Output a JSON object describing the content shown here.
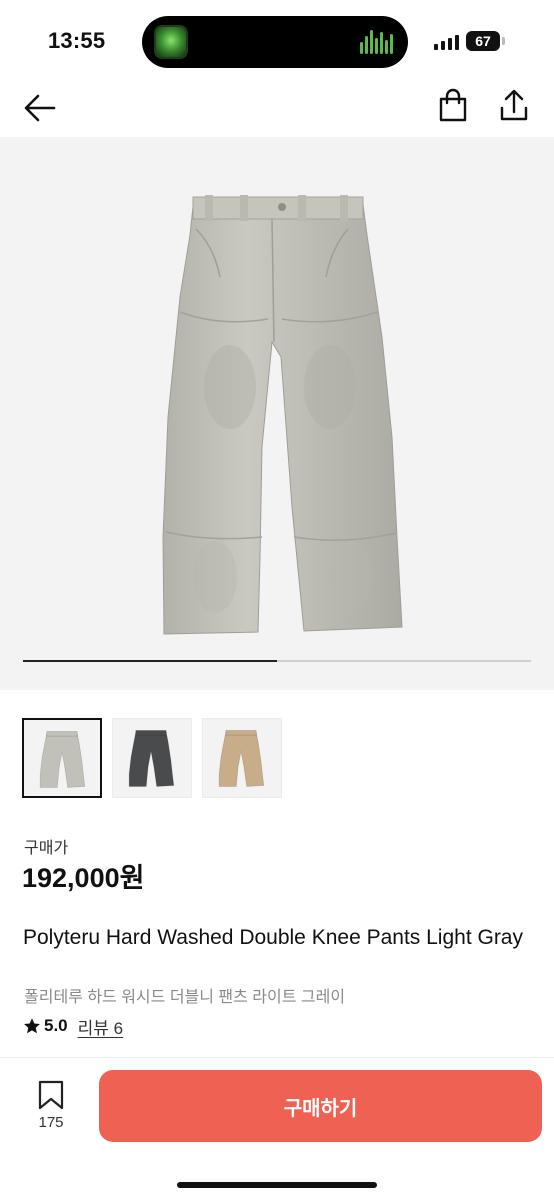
{
  "status_bar": {
    "time": "13:55",
    "battery": "67",
    "icons": [
      "live-activity-app-icon",
      "audio-waveform-icon",
      "signal-icon",
      "battery-icon"
    ]
  },
  "nav": {
    "icons": [
      "back-arrow-icon",
      "shopping-bag-icon",
      "share-icon"
    ]
  },
  "gallery": {
    "progress": 0.5,
    "thumbnails": [
      {
        "name": "light-gray",
        "color": "#c2c1b9",
        "selected": true
      },
      {
        "name": "charcoal",
        "color": "#4a4b4c",
        "selected": false
      },
      {
        "name": "beige",
        "color": "#c7ad88",
        "selected": false
      }
    ]
  },
  "product": {
    "price_label": "구매가",
    "price": "192,000원",
    "title_en": "Polyteru Hard Washed Double Knee Pants Light Gray",
    "title_kr": "폴리테루 하드 워시드 더블니 팬츠 라이트 그레이",
    "rating": "5.0",
    "review_label": "리뷰 6"
  },
  "bottom_bar": {
    "wish_count": "175",
    "buy_label": "구매하기"
  },
  "colors": {
    "accent": "#ee6153",
    "hero_background": "#f3f3f3"
  }
}
